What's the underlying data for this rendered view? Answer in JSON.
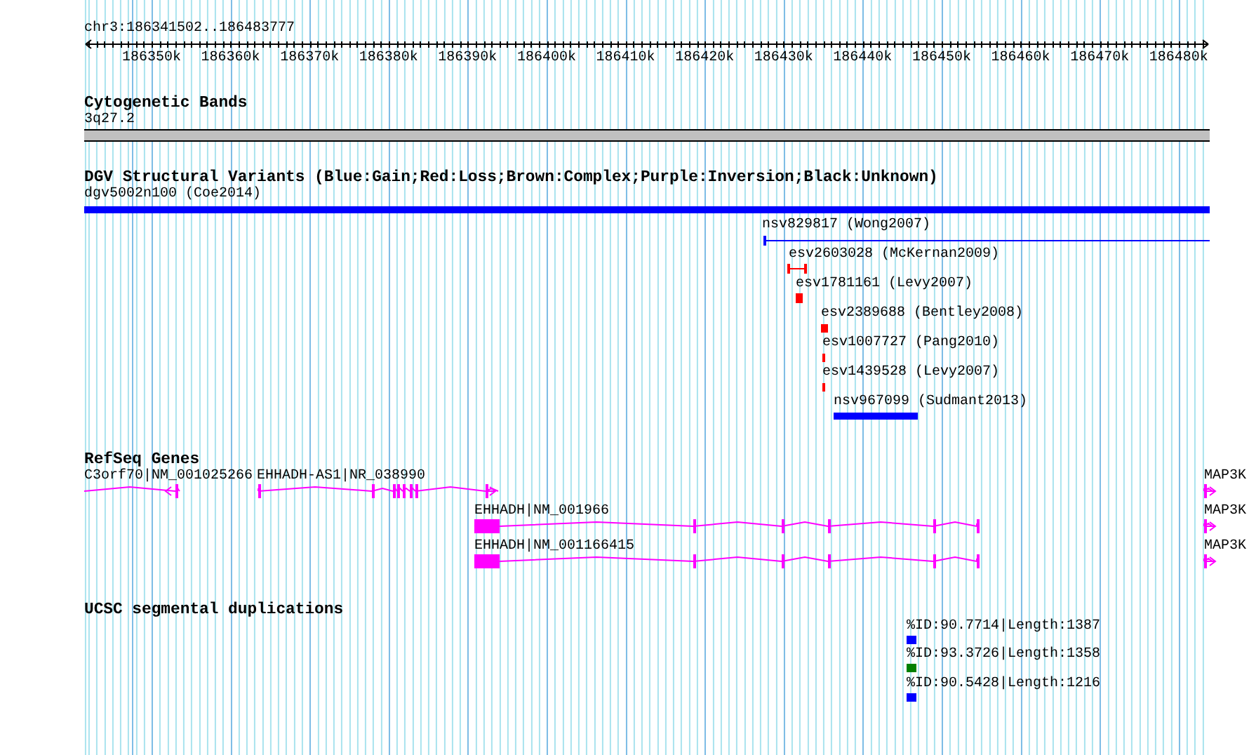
{
  "ruler": {
    "location": "chr3:186341502..186483777",
    "tick_labels": [
      "186350k",
      "186360k",
      "186370k",
      "186380k",
      "186390k",
      "186400k",
      "186410k",
      "186420k",
      "186430k",
      "186440k",
      "186450k",
      "186460k",
      "186470k",
      "186480k"
    ]
  },
  "cytogenetic_bands": {
    "title": "Cytogenetic Bands",
    "band": "3q27.2"
  },
  "dgv_structural_variants": {
    "title": "DGV Structural Variants (Blue:Gain;Red:Loss;Brown:Complex;Purple:Inversion;Black:Unknown)",
    "variants": [
      {
        "label": "dgv5002n100 (Coe2014)",
        "color": "#0000ff"
      },
      {
        "label": "nsv829817 (Wong2007)",
        "color": "#0000ff"
      },
      {
        "label": "esv2603028 (McKernan2009)",
        "color": "#ff0000"
      },
      {
        "label": "esv1781161 (Levy2007)",
        "color": "#ff0000"
      },
      {
        "label": "esv2389688 (Bentley2008)",
        "color": "#ff0000"
      },
      {
        "label": "esv1007727 (Pang2010)",
        "color": "#ff0000"
      },
      {
        "label": "esv1439528 (Levy2007)",
        "color": "#ff0000"
      },
      {
        "label": "nsv967099 (Sudmant2013)",
        "color": "#0000ff"
      }
    ]
  },
  "refseq_genes": {
    "title": "RefSeq Genes",
    "transcripts": [
      {
        "label": "C3orf70|NM_001025266",
        "kind": "reverse"
      },
      {
        "label": "EHHADH-AS1|NR_038990",
        "kind": "forward"
      },
      {
        "label": "MAP3K",
        "kind": "forward"
      },
      {
        "label": "EHHADH|NM_001966",
        "kind": "plain"
      },
      {
        "label": "MAP3K",
        "kind": "forward"
      },
      {
        "label": "EHHADH|NM_001166415",
        "kind": "plain"
      },
      {
        "label": "MAP3K",
        "kind": "forward"
      }
    ]
  },
  "ucsc_segmental_duplications": {
    "title": "UCSC segmental duplications",
    "items": [
      {
        "label": "%ID:90.7714|Length:1387",
        "color": "#0000ff"
      },
      {
        "label": "%ID:93.3726|Length:1358",
        "color": "#008000"
      },
      {
        "label": "%ID:90.5428|Length:1216",
        "color": "#0000ff"
      }
    ]
  }
}
